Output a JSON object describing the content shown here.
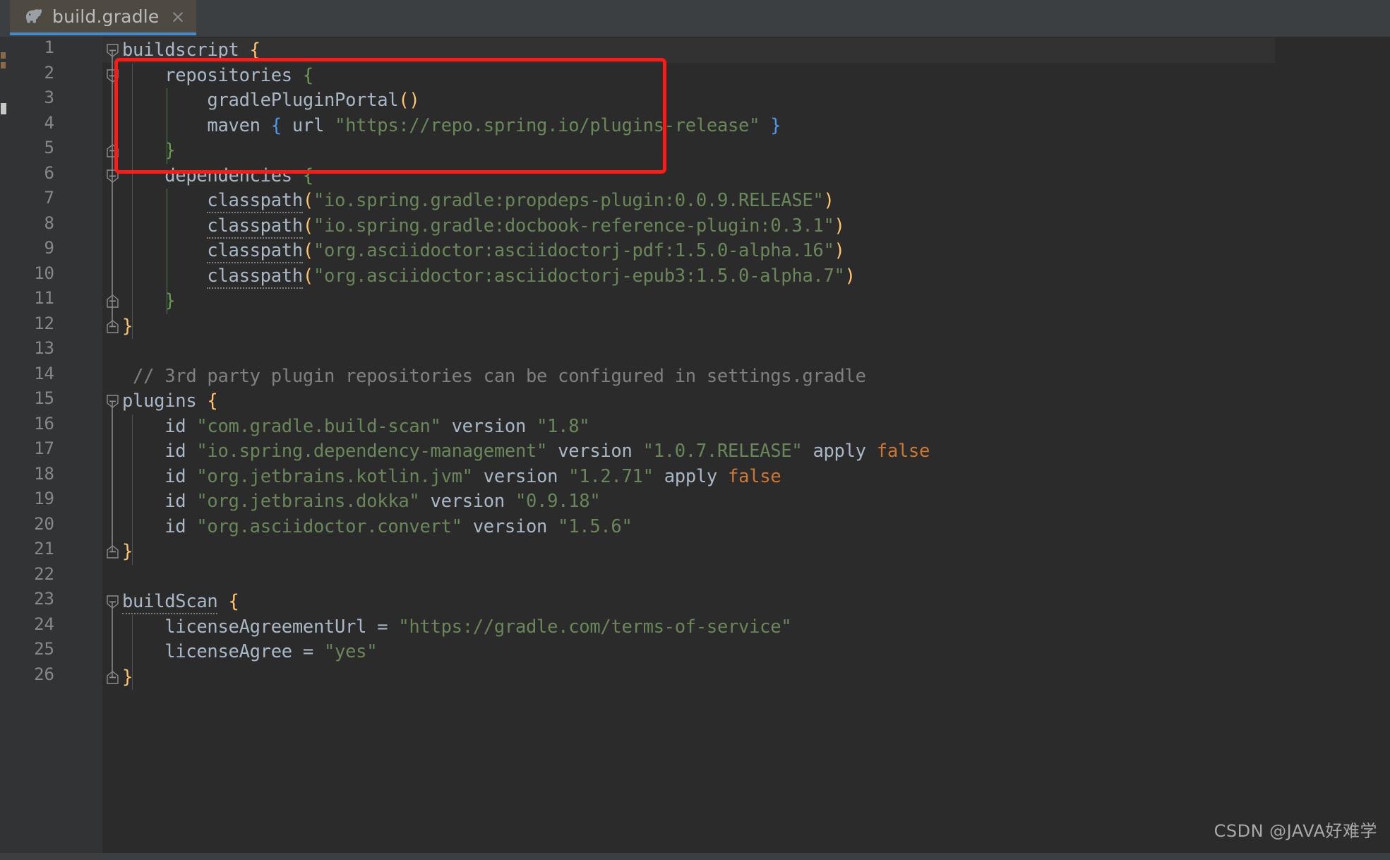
{
  "window": {
    "theme": "darcula",
    "background": "#2b2b2b"
  },
  "tab": {
    "label": "build.gradle",
    "icon": "gradle-elephant-icon",
    "close_label": "×",
    "active": true,
    "active_underline_color": "#4a88c7"
  },
  "colors": {
    "editor_bg": "#2b2b2b",
    "gutter_bg": "#313335",
    "tabbar_bg": "#3c3f41",
    "tab_active_bg": "#4e4a42",
    "line_number": "#888888",
    "text": "#a9b7c6",
    "string": "#6a8759",
    "comment": "#808080",
    "keyword": "#cc7832",
    "brace_yellow": "#ffc66d",
    "brace_green": "#6a9955",
    "brace_blue": "#4a9cf0",
    "annotation_red": "#ff1a15"
  },
  "annotation": {
    "name": "red-highlight-rectangle",
    "covers_lines": "2-5",
    "color": "#ff1a15"
  },
  "gutter": {
    "line_numbers": [
      "1",
      "2",
      "3",
      "4",
      "5",
      "6",
      "7",
      "8",
      "9",
      "10",
      "11",
      "12",
      "13",
      "14",
      "15",
      "16",
      "17",
      "18",
      "19",
      "20",
      "21",
      "22",
      "23",
      "24",
      "25",
      "26"
    ]
  },
  "code": {
    "filename": "build.gradle",
    "lines": [
      {
        "n": "1",
        "tokens": [
          {
            "t": "buildscript ",
            "c": "plain"
          },
          {
            "t": "{",
            "c": "brace-y"
          }
        ]
      },
      {
        "n": "2",
        "tokens": [
          {
            "t": "    repositories ",
            "c": "plain"
          },
          {
            "t": "{",
            "c": "brace-g"
          }
        ]
      },
      {
        "n": "3",
        "tokens": [
          {
            "t": "        gradlePluginPortal",
            "c": "plain"
          },
          {
            "t": "()",
            "c": "paren-y"
          }
        ]
      },
      {
        "n": "4",
        "tokens": [
          {
            "t": "        maven ",
            "c": "plain"
          },
          {
            "t": "{",
            "c": "brace-b"
          },
          {
            "t": " url ",
            "c": "plain"
          },
          {
            "t": "\"https://repo.spring.io/plugins-release\"",
            "c": "str"
          },
          {
            "t": " ",
            "c": "plain"
          },
          {
            "t": "}",
            "c": "brace-b"
          }
        ]
      },
      {
        "n": "5",
        "tokens": [
          {
            "t": "    ",
            "c": "plain"
          },
          {
            "t": "}",
            "c": "brace-g"
          }
        ]
      },
      {
        "n": "6",
        "tokens": [
          {
            "t": "    dependencies ",
            "c": "plain"
          },
          {
            "t": "{",
            "c": "brace-g"
          }
        ]
      },
      {
        "n": "7",
        "tokens": [
          {
            "t": "        ",
            "c": "plain"
          },
          {
            "t": "classpath",
            "c": "under"
          },
          {
            "t": "(",
            "c": "paren-y"
          },
          {
            "t": "\"io.spring.gradle:propdeps-plugin:0.0.9.RELEASE\"",
            "c": "str"
          },
          {
            "t": ")",
            "c": "paren-y"
          }
        ]
      },
      {
        "n": "8",
        "tokens": [
          {
            "t": "        ",
            "c": "plain"
          },
          {
            "t": "classpath",
            "c": "under"
          },
          {
            "t": "(",
            "c": "paren-y"
          },
          {
            "t": "\"io.spring.gradle:docbook-reference-plugin:0.3.1\"",
            "c": "str"
          },
          {
            "t": ")",
            "c": "paren-y"
          }
        ]
      },
      {
        "n": "9",
        "tokens": [
          {
            "t": "        ",
            "c": "plain"
          },
          {
            "t": "classpath",
            "c": "under"
          },
          {
            "t": "(",
            "c": "paren-y"
          },
          {
            "t": "\"org.asciidoctor:asciidoctorj-pdf:1.5.0-alpha.16\"",
            "c": "str"
          },
          {
            "t": ")",
            "c": "paren-y"
          }
        ]
      },
      {
        "n": "10",
        "tokens": [
          {
            "t": "        ",
            "c": "plain"
          },
          {
            "t": "classpath",
            "c": "under"
          },
          {
            "t": "(",
            "c": "paren-y"
          },
          {
            "t": "\"org.asciidoctor:asciidoctorj-epub3:1.5.0-alpha.7\"",
            "c": "str"
          },
          {
            "t": ")",
            "c": "paren-y"
          }
        ]
      },
      {
        "n": "11",
        "tokens": [
          {
            "t": "    ",
            "c": "plain"
          },
          {
            "t": "}",
            "c": "brace-g"
          }
        ]
      },
      {
        "n": "12",
        "tokens": [
          {
            "t": "}",
            "c": "brace-y"
          }
        ]
      },
      {
        "n": "13",
        "tokens": []
      },
      {
        "n": "14",
        "tokens": [
          {
            "t": " // 3rd party plugin repositories can be configured in settings.gradle",
            "c": "cmt"
          }
        ]
      },
      {
        "n": "15",
        "tokens": [
          {
            "t": "plugins ",
            "c": "plain"
          },
          {
            "t": "{",
            "c": "brace-y"
          }
        ]
      },
      {
        "n": "16",
        "tokens": [
          {
            "t": "    id ",
            "c": "plain"
          },
          {
            "t": "\"com.gradle.build-scan\"",
            "c": "str"
          },
          {
            "t": " version ",
            "c": "plain"
          },
          {
            "t": "\"1.8\"",
            "c": "str"
          }
        ]
      },
      {
        "n": "17",
        "tokens": [
          {
            "t": "    id ",
            "c": "plain"
          },
          {
            "t": "\"io.spring.dependency-management\"",
            "c": "str"
          },
          {
            "t": " version ",
            "c": "plain"
          },
          {
            "t": "\"1.0.7.RELEASE\"",
            "c": "str"
          },
          {
            "t": " apply ",
            "c": "plain"
          },
          {
            "t": "false",
            "c": "kw"
          }
        ]
      },
      {
        "n": "18",
        "tokens": [
          {
            "t": "    id ",
            "c": "plain"
          },
          {
            "t": "\"org.jetbrains.kotlin.jvm\"",
            "c": "str"
          },
          {
            "t": " version ",
            "c": "plain"
          },
          {
            "t": "\"1.2.71\"",
            "c": "str"
          },
          {
            "t": " apply ",
            "c": "plain"
          },
          {
            "t": "false",
            "c": "kw"
          }
        ]
      },
      {
        "n": "19",
        "tokens": [
          {
            "t": "    id ",
            "c": "plain"
          },
          {
            "t": "\"org.jetbrains.dokka\"",
            "c": "str"
          },
          {
            "t": " version ",
            "c": "plain"
          },
          {
            "t": "\"0.9.18\"",
            "c": "str"
          }
        ]
      },
      {
        "n": "20",
        "tokens": [
          {
            "t": "    id ",
            "c": "plain"
          },
          {
            "t": "\"org.asciidoctor.convert\"",
            "c": "str"
          },
          {
            "t": " version ",
            "c": "plain"
          },
          {
            "t": "\"1.5.6\"",
            "c": "str"
          }
        ]
      },
      {
        "n": "21",
        "tokens": [
          {
            "t": "}",
            "c": "brace-y"
          }
        ]
      },
      {
        "n": "22",
        "tokens": []
      },
      {
        "n": "23",
        "tokens": [
          {
            "t": "buildScan",
            "c": "under"
          },
          {
            "t": " ",
            "c": "plain"
          },
          {
            "t": "{",
            "c": "brace-y"
          }
        ]
      },
      {
        "n": "24",
        "tokens": [
          {
            "t": "    licenseAgreementUrl = ",
            "c": "plain"
          },
          {
            "t": "\"https://gradle.com/terms-of-service\"",
            "c": "str"
          }
        ]
      },
      {
        "n": "25",
        "tokens": [
          {
            "t": "    licenseAgree = ",
            "c": "plain"
          },
          {
            "t": "\"yes\"",
            "c": "str"
          }
        ]
      },
      {
        "n": "26",
        "tokens": [
          {
            "t": "}",
            "c": "brace-y"
          }
        ]
      }
    ]
  },
  "watermark": {
    "text": "CSDN @JAVA好难学"
  }
}
